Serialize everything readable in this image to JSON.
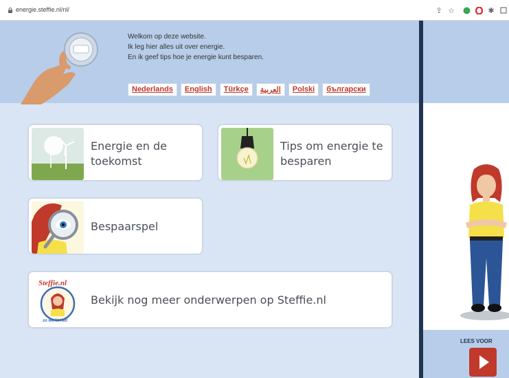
{
  "browser": {
    "url": "energie.steffie.nl/nl/",
    "extension_icons": [
      "share-icon",
      "star-icon",
      "evernote-icon",
      "opera-icon",
      "puzzle-icon",
      "sidebar-icon"
    ]
  },
  "header": {
    "welcome_lines": [
      "Welkom op deze website.",
      "Ik leg hier alles uit over energie.",
      "En ik geef tips hoe je energie kunt besparen."
    ],
    "languages": [
      "Nederlands",
      "English",
      "Türkçe",
      "العربية",
      "Polski",
      "български"
    ]
  },
  "cards": [
    {
      "label_lines": [
        "Energie en de",
        "toekomst"
      ],
      "icon": "wind-turbine-icon"
    },
    {
      "label_lines": [
        "Tips om energie te",
        "besparen"
      ],
      "icon": "lightbulb-icon"
    },
    {
      "label_lines": [
        "Bespaarspel"
      ],
      "icon": "magnifier-icon"
    },
    {
      "label_lines": [
        "Bekijk nog meer onderwerpen op Steffie.nl"
      ],
      "icon": "steffie-logo-icon"
    }
  ],
  "logo": {
    "title": "Steffie.nl",
    "tagline": "zo werkt het!"
  },
  "right_panel": {
    "read_aloud_label": "LEES VOOR"
  },
  "colors": {
    "header_bg": "#b7cde9",
    "page_bg": "#d9e5f4",
    "accent_red": "#c0392b",
    "divider": "#1f3550"
  }
}
